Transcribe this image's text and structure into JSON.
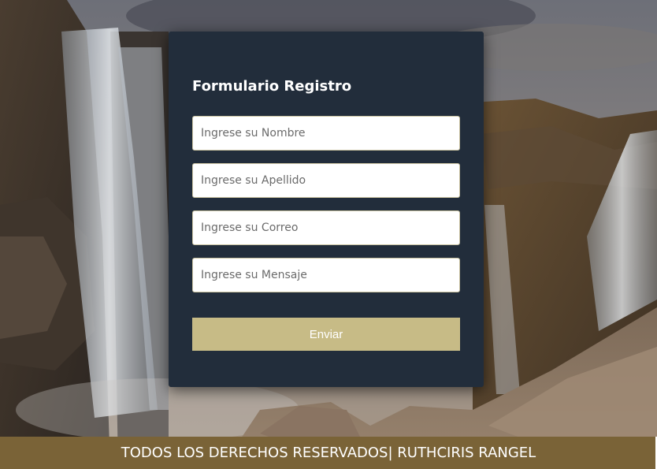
{
  "form": {
    "title": "Formulario Registro",
    "fields": [
      {
        "placeholder": "Ingrese su Nombre",
        "value": ""
      },
      {
        "placeholder": "Ingrese su Apellido",
        "value": ""
      },
      {
        "placeholder": "Ingrese su Correo",
        "value": ""
      },
      {
        "placeholder": "Ingrese su Mensaje",
        "value": ""
      }
    ],
    "submit_label": "Enviar"
  },
  "footer": {
    "text": "TODOS LOS DERECHOS RESERVADOS| RUTHCIRIS RANGEL"
  },
  "colors": {
    "card": "#222d3b",
    "button": "#c7bb86",
    "footer": "#7a6337"
  }
}
